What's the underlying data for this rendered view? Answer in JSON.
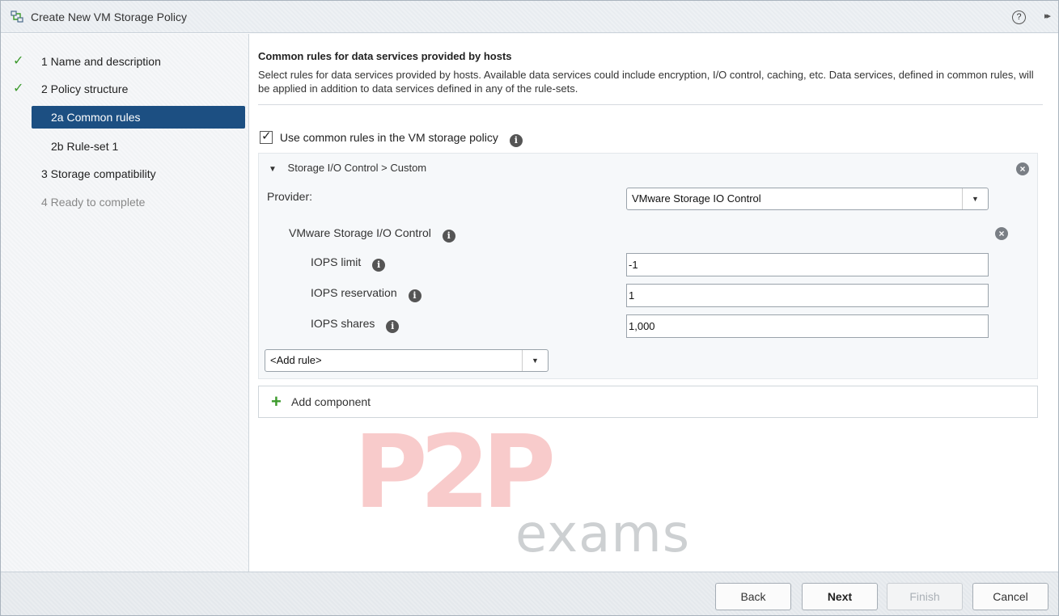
{
  "window": {
    "title": "Create New VM Storage Policy",
    "help": "?",
    "expand": "▸▸"
  },
  "sidebar": {
    "steps": [
      {
        "label": "1  Name and description",
        "state": "done"
      },
      {
        "label": "2  Policy structure",
        "state": "done"
      },
      {
        "label": "2a  Common rules",
        "state": "active"
      },
      {
        "label": "2b  Rule-set 1",
        "state": "sub"
      },
      {
        "label": "3  Storage compatibility",
        "state": "normal"
      },
      {
        "label": "4  Ready to complete",
        "state": "disabled"
      }
    ]
  },
  "main": {
    "title": "Common rules for data services provided by hosts",
    "description": "Select rules for data services provided by hosts. Available data services could include encryption, I/O control, caching, etc. Data services, defined in common rules, will be applied in addition to data services defined in any of the rule-sets.",
    "use_common_rules": {
      "label": "Use common rules in the VM storage policy",
      "checked": true
    },
    "rule": {
      "header": "Storage I/O Control > Custom",
      "provider_label": "Provider:",
      "provider_value": "VMware Storage IO Control",
      "group_label": "VMware Storage I/O Control",
      "fields": [
        {
          "label": "IOPS limit",
          "value": "-1"
        },
        {
          "label": "IOPS reservation",
          "value": "1"
        },
        {
          "label": "IOPS shares",
          "value": "1,000"
        }
      ],
      "add_rule": "<Add rule>"
    },
    "add_component": "Add component"
  },
  "watermark": {
    "big": "P2P",
    "small": "exams"
  },
  "footer": {
    "back": "Back",
    "next": "Next",
    "finish": "Finish",
    "cancel": "Cancel"
  },
  "colors": {
    "accent": "#1c4f82",
    "check": "#3c9a2c"
  }
}
